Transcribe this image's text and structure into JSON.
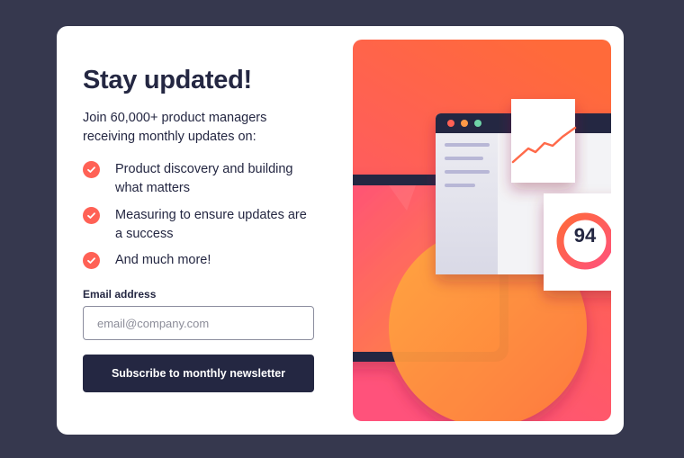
{
  "signup": {
    "title": "Stay updated!",
    "intro": "Join 60,000+ product managers receiving monthly updates on:",
    "features": [
      "Product discovery and building what matters",
      "Measuring to ensure updates are a success",
      "And much more!"
    ],
    "email_label": "Email address",
    "email_placeholder": "email@company.com",
    "email_value": "",
    "subscribe_label": "Subscribe to monthly newsletter"
  },
  "illustration": {
    "score": "94"
  },
  "colors": {
    "page_background": "#36384e",
    "card_background": "#ffffff",
    "text_dark": "#242742",
    "accent_tomato": "#ff6155",
    "gradient_top": "#ff6a3a",
    "gradient_bottom": "#ff527b"
  },
  "icons": {
    "feature_bullet": "check-circle-icon"
  }
}
